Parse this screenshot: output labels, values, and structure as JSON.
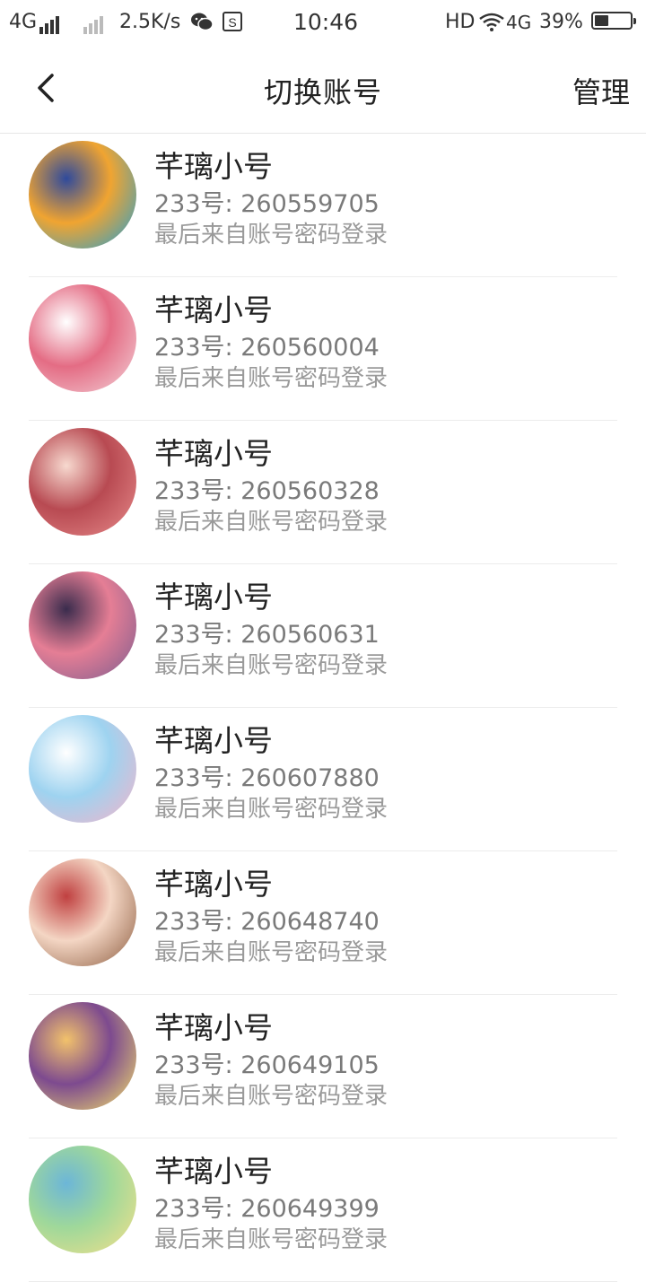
{
  "status_bar": {
    "network_left": "4G",
    "speed": "2.5K/s",
    "time": "10:46",
    "hd": "HD",
    "network_right": "4G",
    "battery": "39%",
    "battery_level": 0.39
  },
  "header": {
    "title": "切换账号",
    "manage_label": "管理"
  },
  "accounts": [
    {
      "name": "芊璃小号",
      "uid": "233号: 260559705",
      "login": "最后来自账号密码登录",
      "colors": [
        "#1e9fd6",
        "#f0a431",
        "#2f4a9c"
      ]
    },
    {
      "name": "芊璃小号",
      "uid": "233号: 260560004",
      "login": "最后来自账号密码登录",
      "colors": [
        "#f3d4da",
        "#e46c84",
        "#ffffff"
      ]
    },
    {
      "name": "芊璃小号",
      "uid": "233号: 260560328",
      "login": "最后来自账号密码登录",
      "colors": [
        "#e88c8c",
        "#b84a52",
        "#f7d9cf"
      ]
    },
    {
      "name": "芊璃小号",
      "uid": "233号: 260560631",
      "login": "最后来自账号密码登录",
      "colors": [
        "#7b5c8f",
        "#e57e95",
        "#3a2c4d"
      ]
    },
    {
      "name": "芊璃小号",
      "uid": "233号: 260607880",
      "login": "最后来自账号密码登录",
      "colors": [
        "#f6b3c9",
        "#9ed3f0",
        "#ffffff"
      ]
    },
    {
      "name": "芊璃小号",
      "uid": "233号: 260648740",
      "login": "最后来自账号密码登录",
      "colors": [
        "#8a5a3d",
        "#f4d6c4",
        "#c04040"
      ]
    },
    {
      "name": "芊璃小号",
      "uid": "233号: 260649105",
      "login": "最后来自账号密码登录",
      "colors": [
        "#f7e66a",
        "#7d4a8f",
        "#f2c26b"
      ]
    },
    {
      "name": "芊璃小号",
      "uid": "233号: 260649399",
      "login": "最后来自账号密码登录",
      "colors": [
        "#f6e08a",
        "#9fd89a",
        "#6cb6d8"
      ]
    }
  ]
}
